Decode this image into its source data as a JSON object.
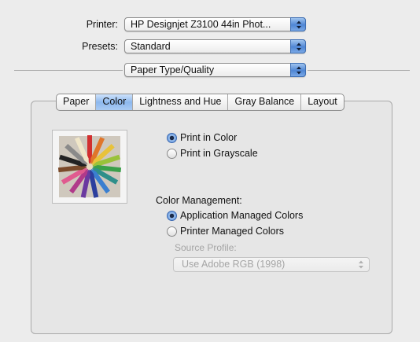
{
  "printer": {
    "label": "Printer:",
    "value": "HP Designjet Z3100 44in Phot..."
  },
  "presets": {
    "label": "Presets:",
    "value": "Standard"
  },
  "pane_selector": {
    "value": "Paper Type/Quality"
  },
  "tabs": [
    {
      "label": "Paper",
      "active": false
    },
    {
      "label": "Color",
      "active": true
    },
    {
      "label": "Lightness and Hue",
      "active": false
    },
    {
      "label": "Gray Balance",
      "active": false
    },
    {
      "label": "Layout",
      "active": false
    }
  ],
  "preview_image": {
    "icon": "colored-pencils-image"
  },
  "color_mode": {
    "options": [
      {
        "label": "Print in Color",
        "selected": true
      },
      {
        "label": "Print in Grayscale",
        "selected": false
      }
    ]
  },
  "color_management": {
    "heading": "Color Management:",
    "options": [
      {
        "label": "Application Managed Colors",
        "selected": true
      },
      {
        "label": "Printer Managed Colors",
        "selected": false
      }
    ],
    "source_profile": {
      "label": "Source Profile:",
      "value": "Use Adobe RGB (1998)",
      "enabled": false
    }
  },
  "colors": {
    "accent": "#4f86d4",
    "disabled_text": "#a5a5a5"
  }
}
